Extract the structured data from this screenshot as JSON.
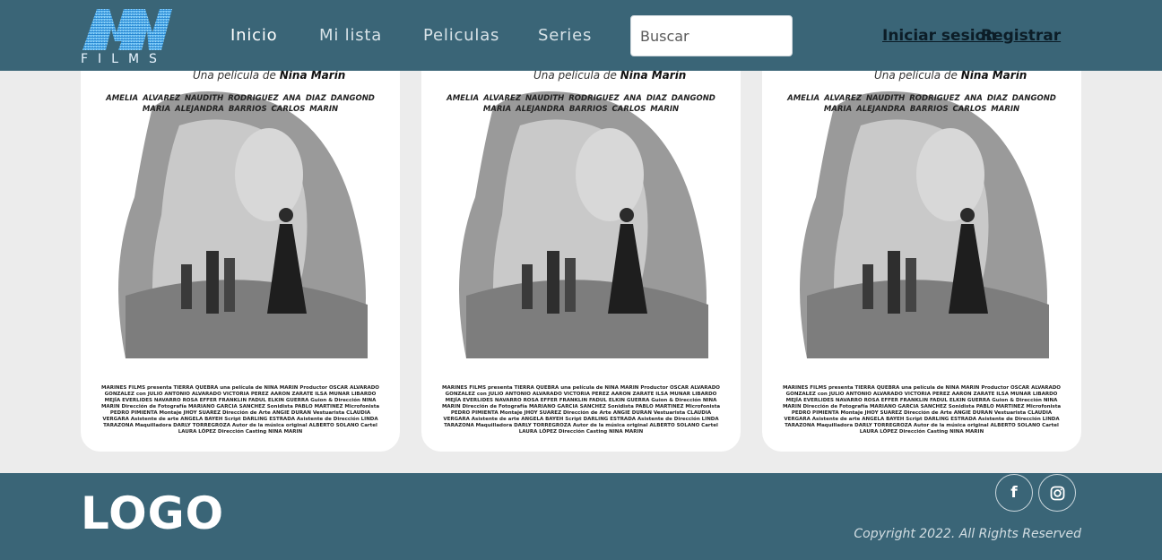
{
  "brand": {
    "logo_sub": "FILMS",
    "accent_color": "#3a6577",
    "logo_color": "#1aa0e8"
  },
  "nav": {
    "items": [
      {
        "label": "Inicio",
        "active": true
      },
      {
        "label": "Mi lista",
        "active": false
      },
      {
        "label": "Peliculas",
        "active": false
      },
      {
        "label": "Series",
        "active": false
      }
    ]
  },
  "search": {
    "placeholder": "Buscar"
  },
  "auth": {
    "login_label": "Iniciar sesion",
    "register_label": "Registrar"
  },
  "movies": [
    {
      "tagline_prefix": "Una película de",
      "director": "Nina Marín",
      "cast_line1": "AMELIA ALVAREZ    NAUDITH RODRIGUEZ    ANA DIAZ DANGOND",
      "cast_line2": "MARIA ALEJANDRA BARRIOS    CARLOS MARIN",
      "credits": "MARINES FILMS presenta TIERRA QUEBRA una película de NINA MARIN Productor OSCAR ALVARADO GONZALEZ con JULIO ANTONIO ALVARADO VICTORIA PEREZ AARON ZARATE ILSA MUNAR LIBARDO MEJÍA EVERLIDES NAVARRO ROSA EFFER FRANKLIN FADUL ELKIN GUERRA Guion & Dirección NINA MARIN Dirección de Fotografía MARIANO GARCIA SANCHEZ Sonidista PABLO MARTINEZ Microfonista PEDRO PIMIENTA Montaje JHOY SUAREZ Dirección de Arte ANGIE DURAN Vestuarista CLAUDIA VERGARA Asistente de arte ANGELA BAYEH Script DARLING ESTRADA Asistente de Dirección LINDA TARAZONA Maquilladora DARLY TORREGROZA Autor de la música original ALBERTO SOLANO Cartel LAURA LÓPEZ Dirección Casting NINA MARIN"
    },
    {
      "tagline_prefix": "Una película de",
      "director": "Nina Marín",
      "cast_line1": "AMELIA ALVAREZ    NAUDITH RODRIGUEZ    ANA DIAZ DANGOND",
      "cast_line2": "MARIA ALEJANDRA BARRIOS    CARLOS MARIN",
      "credits": "MARINES FILMS presenta TIERRA QUEBRA una película de NINA MARIN Productor OSCAR ALVARADO GONZALEZ con JULIO ANTONIO ALVARADO VICTORIA PEREZ AARON ZARATE ILSA MUNAR LIBARDO MEJÍA EVERLIDES NAVARRO ROSA EFFER FRANKLIN FADUL ELKIN GUERRA Guion & Dirección NINA MARIN Dirección de Fotografía MARIANO GARCIA SANCHEZ Sonidista PABLO MARTINEZ Microfonista PEDRO PIMIENTA Montaje JHOY SUAREZ Dirección de Arte ANGIE DURAN Vestuarista CLAUDIA VERGARA Asistente de arte ANGELA BAYEH Script DARLING ESTRADA Asistente de Dirección LINDA TARAZONA Maquilladora DARLY TORREGROZA Autor de la música original ALBERTO SOLANO Cartel LAURA LÓPEZ Dirección Casting NINA MARIN"
    },
    {
      "tagline_prefix": "Una película de",
      "director": "Nina Marín",
      "cast_line1": "AMELIA ALVAREZ    NAUDITH RODRIGUEZ    ANA DIAZ DANGOND",
      "cast_line2": "MARIA ALEJANDRA BARRIOS    CARLOS MARIN",
      "credits": "MARINES FILMS presenta TIERRA QUEBRA una película de NINA MARIN Productor OSCAR ALVARADO GONZALEZ con JULIO ANTONIO ALVARADO VICTORIA PEREZ AARON ZARATE ILSA MUNAR LIBARDO MEJÍA EVERLIDES NAVARRO ROSA EFFER FRANKLIN FADUL ELKIN GUERRA Guion & Dirección NINA MARIN Dirección de Fotografía MARIANO GARCIA SANCHEZ Sonidista PABLO MARTINEZ Microfonista PEDRO PIMIENTA Montaje JHOY SUAREZ Dirección de Arte ANGIE DURAN Vestuarista CLAUDIA VERGARA Asistente de arte ANGELA BAYEH Script DARLING ESTRADA Asistente de Dirección LINDA TARAZONA Maquilladora DARLY TORREGROZA Autor de la música original ALBERTO SOLANO Cartel LAURA LÓPEZ Dirección Casting NINA MARIN"
    }
  ],
  "footer": {
    "logo_text": "LOGO",
    "social": [
      {
        "icon": "facebook-icon",
        "glyph": "f"
      },
      {
        "icon": "instagram-icon",
        "glyph": ""
      }
    ],
    "copyright": "Copyright 2022. All Rights Reserved"
  }
}
